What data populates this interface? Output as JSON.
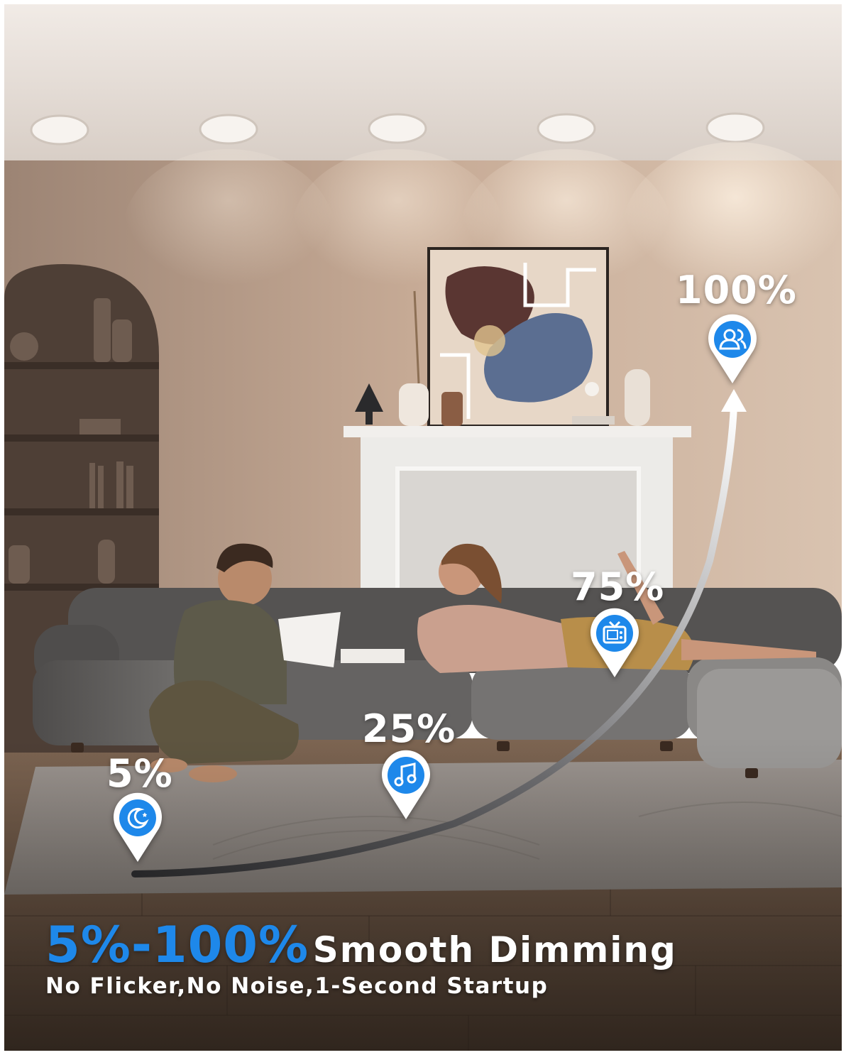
{
  "headline": {
    "accent": "5%-100%",
    "text": "Smooth Dimming"
  },
  "subline": "No Flicker,No Noise,1-Second Startup",
  "levels": [
    {
      "label": "5%",
      "icon": "moon-icon"
    },
    {
      "label": "25%",
      "icon": "music-note-icon"
    },
    {
      "label": "75%",
      "icon": "tv-icon"
    },
    {
      "label": "100%",
      "icon": "people-icon"
    }
  ],
  "colors": {
    "accent_blue": "#1e88ea",
    "pin_white": "#ffffff",
    "wall": "#c9ad96",
    "ceiling": "#e4dcd6",
    "sofa": "#6e6c6a",
    "floor": "#6b5340"
  }
}
